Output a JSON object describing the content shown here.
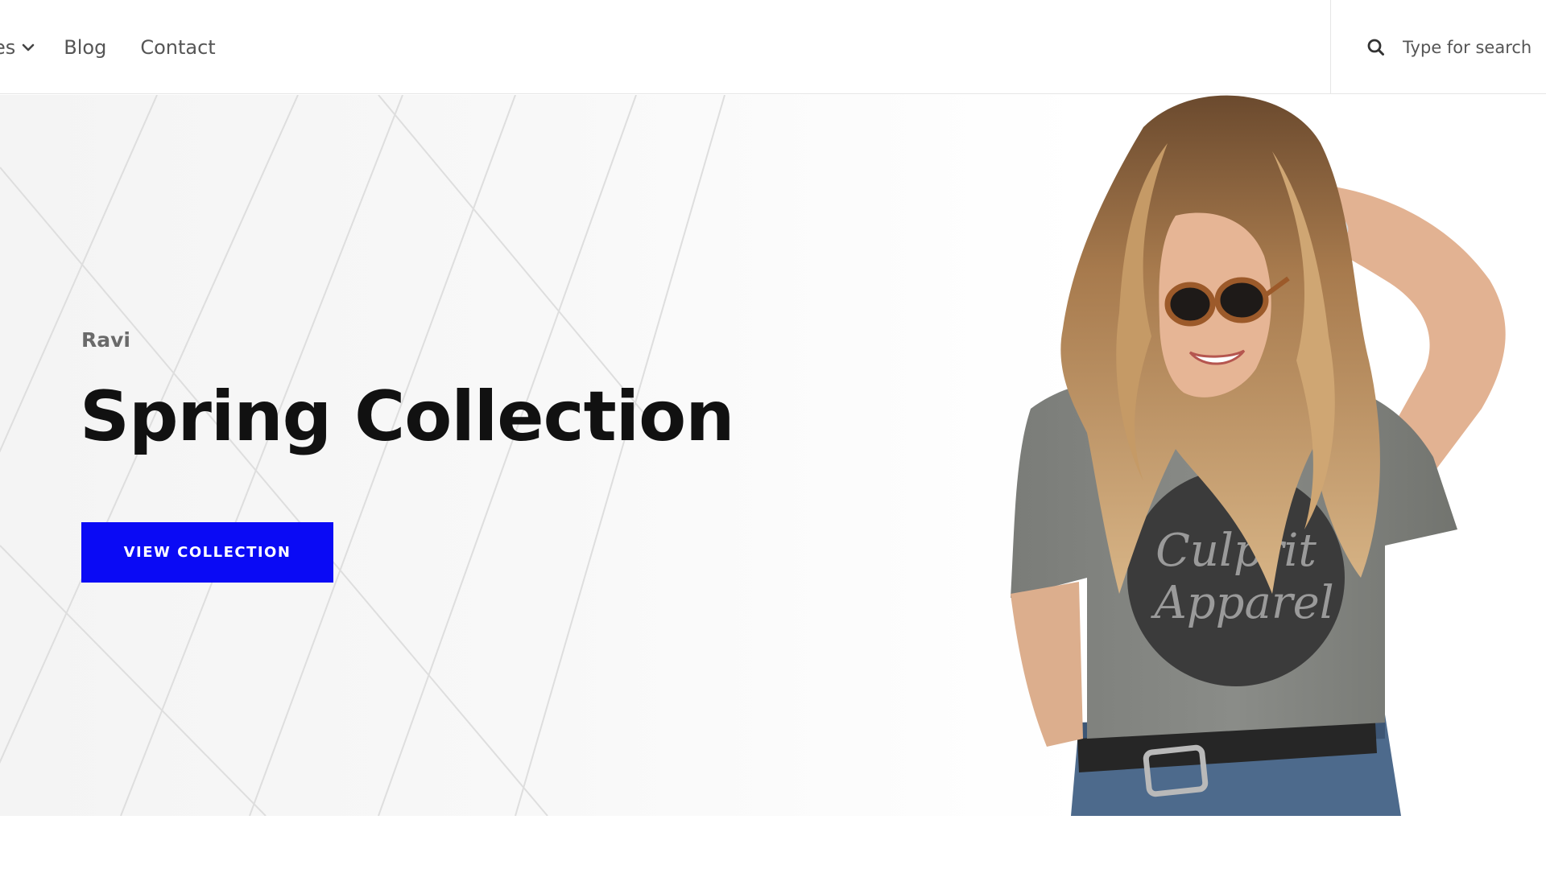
{
  "header": {
    "nav": {
      "pages_label": "es",
      "blog_label": "Blog",
      "contact_label": "Contact"
    },
    "search": {
      "placeholder": "Type for search"
    }
  },
  "hero": {
    "subtitle": "Ravi",
    "title": "Spring Collection",
    "button_label": "VIEW COLLECTION",
    "shirt_text_line1": "Culprit",
    "shirt_text_line2": "Apparel"
  },
  "colors": {
    "accent": "#0a0af5",
    "nav_text": "#555555",
    "title_text": "#111111",
    "subtitle_text": "#6a6a6a"
  },
  "icons": {
    "nav_dropdown": "chevron-down-icon",
    "search": "search-icon"
  }
}
